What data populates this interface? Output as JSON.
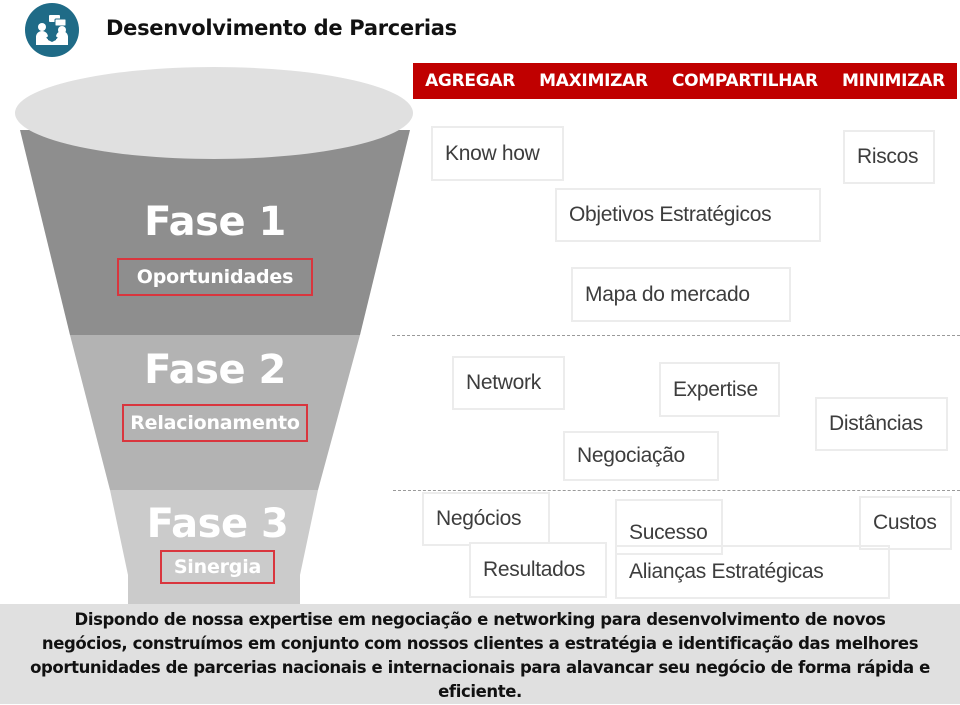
{
  "header": {
    "title": "Desenvolvimento de Parcerias",
    "logo_icon": "partnership-meeting-icon",
    "logo_color": "#1f6b87"
  },
  "action_bar": {
    "color": "#c00000",
    "labels": [
      "AGREGAR",
      "MAXIMIZAR",
      "COMPARTILHAR",
      "MINIMIZAR"
    ]
  },
  "funnel": {
    "phases": [
      {
        "title": "Fase 1",
        "subtitle": "Oportunidades",
        "color": "#8e8e8e"
      },
      {
        "title": "Fase 2",
        "subtitle": "Relacionamento",
        "color": "#b3b3b3"
      },
      {
        "title": "Fase 3",
        "subtitle": "Sinergia",
        "color": "#cbcbcb"
      }
    ],
    "rim_color": "#e0e0e0",
    "highlight_border": "#d9363e"
  },
  "tags": {
    "phase1": [
      "Know how",
      "Riscos",
      "Objetivos Estratégicos",
      "Mapa do mercado"
    ],
    "phase2": [
      "Network",
      "Expertise",
      "Distâncias",
      "Negociação"
    ],
    "phase3": [
      "Negócios",
      "Sucesso",
      "Custos",
      "Resultados",
      "Alianças Estratégicas"
    ]
  },
  "footer": {
    "lines": [
      "Dispondo de nossa expertise em negociação e networking para desenvolvimento de novos",
      "negócios, construímos em conjunto com nossos clientes a estratégia e identificação das melhores",
      "oportunidades de parcerias nacionais e internacionais para alavancar seu negócio de forma rápida e",
      "eficiente."
    ]
  }
}
